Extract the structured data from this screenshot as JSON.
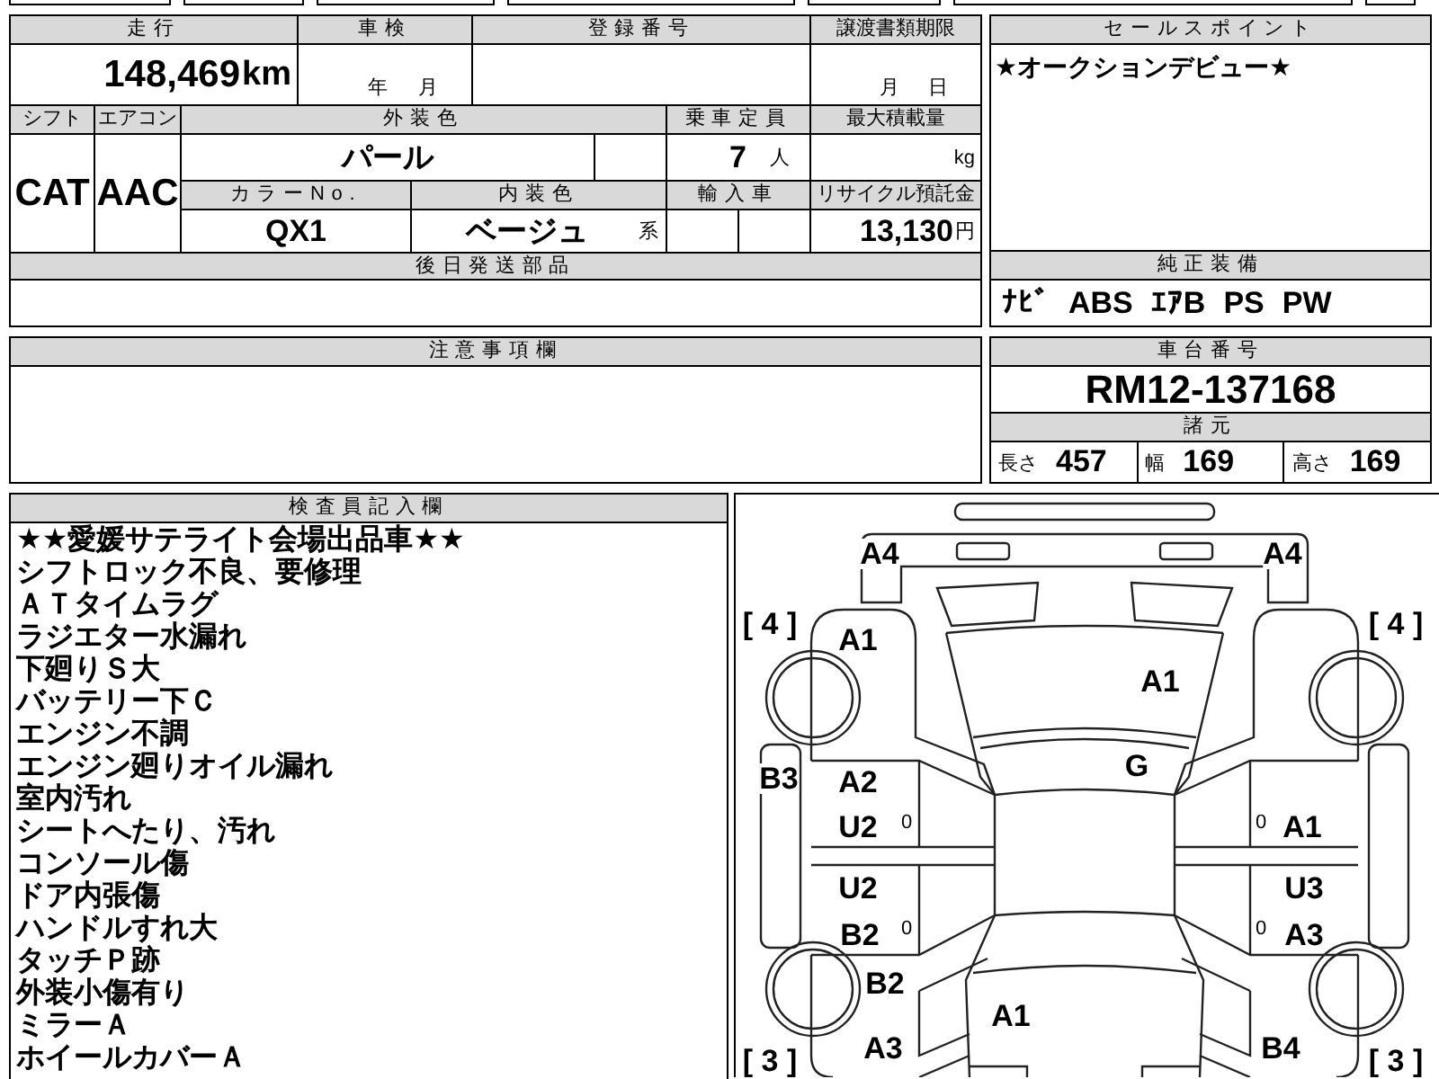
{
  "form": {
    "mileage": {
      "label": "走行",
      "value": "148,469",
      "unit": "km"
    },
    "inspection": {
      "label": "車検",
      "year_unit": "年",
      "month_unit": "月"
    },
    "registration": {
      "label": "登録番号"
    },
    "transfer_deadline": {
      "label": "譲渡書類期限",
      "month_unit": "月",
      "day_unit": "日"
    },
    "shift": {
      "label": "シフト",
      "value": "CAT"
    },
    "aircon": {
      "label": "エアコン",
      "value": "AAC"
    },
    "exterior_color": {
      "label": "外装色",
      "value": "パール"
    },
    "capacity": {
      "label": "乗車定員",
      "value": "7",
      "unit": "人"
    },
    "max_load": {
      "label": "最大積載量",
      "unit": "kg"
    },
    "color_no": {
      "label": "カラーNo.",
      "value": "QX1"
    },
    "interior_color": {
      "label": "内装色",
      "value": "ベージュ",
      "suffix": "系"
    },
    "imported": {
      "label": "輸入車"
    },
    "recycle_fee": {
      "label": "リサイクル預託金",
      "value": "13,130",
      "unit": "円"
    },
    "parts_later": {
      "label": "後日発送部品"
    }
  },
  "sales_point": {
    "label": "セールスポイント",
    "text": "★オークションデビュー★"
  },
  "factory_equipment": {
    "label": "純正装備",
    "items": [
      "ﾅﾋﾞ",
      "ABS",
      "ｴｱB",
      "PS",
      "PW"
    ]
  },
  "notes": {
    "label": "注意事項欄"
  },
  "chassis": {
    "label": "車台番号",
    "value": "RM12-137168"
  },
  "dimensions": {
    "label": "諸元",
    "items": [
      {
        "label": "長さ",
        "value": "457"
      },
      {
        "label": "幅",
        "value": "169"
      },
      {
        "label": "高さ",
        "value": "169"
      }
    ]
  },
  "inspector_notes": {
    "label": "検査員記入欄",
    "lines": [
      "★★愛媛サテライト会場出品車★★",
      "シフトロック不良、要修理",
      "ＡＴタイムラグ",
      "ラジエター水漏れ",
      "下廻りＳ大",
      "バッテリー下Ｃ",
      "エンジン不調",
      "エンジン廻りオイル漏れ",
      "室内汚れ",
      "シートへたり、汚れ",
      "コンソール傷",
      "ドア内張傷",
      "ハンドルすれ大",
      "タッチＰ跡",
      "外装小傷有り",
      "ミラーＡ",
      "ホイールカバーＡ"
    ]
  },
  "damage_diagram": {
    "marks": [
      {
        "kind": "damage",
        "text": "A4"
      },
      {
        "kind": "damage",
        "text": "A4"
      },
      {
        "kind": "count",
        "text": "[ 4 ]"
      },
      {
        "kind": "count",
        "text": "[ 4 ]"
      },
      {
        "kind": "damage",
        "text": "A1"
      },
      {
        "kind": "damage",
        "text": "A1"
      },
      {
        "kind": "damage",
        "text": "G"
      },
      {
        "kind": "damage",
        "text": "B3"
      },
      {
        "kind": "damage",
        "text": "A2"
      },
      {
        "kind": "damage",
        "text": "U2"
      },
      {
        "kind": "minor",
        "text": "0"
      },
      {
        "kind": "minor",
        "text": "0"
      },
      {
        "kind": "damage",
        "text": "A1"
      },
      {
        "kind": "damage",
        "text": "U2"
      },
      {
        "kind": "damage",
        "text": "U3"
      },
      {
        "kind": "damage",
        "text": "B2"
      },
      {
        "kind": "minor",
        "text": "0"
      },
      {
        "kind": "minor",
        "text": "0"
      },
      {
        "kind": "damage",
        "text": "A3"
      },
      {
        "kind": "damage",
        "text": "B2"
      },
      {
        "kind": "damage",
        "text": "A1"
      },
      {
        "kind": "damage",
        "text": "A3"
      },
      {
        "kind": "damage",
        "text": "B4"
      },
      {
        "kind": "count",
        "text": "[ 3 ]"
      },
      {
        "kind": "count",
        "text": "[ 3 ]"
      }
    ]
  }
}
